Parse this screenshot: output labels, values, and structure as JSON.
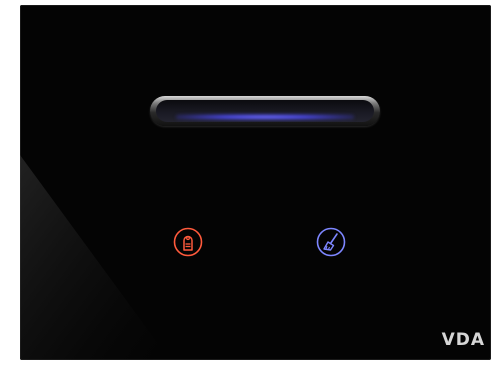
{
  "device": {
    "type": "hotel room keycard switch panel",
    "panel_color": "#040404",
    "card_slot": {
      "icon": "card-slot",
      "glow_color": "#5b59f0"
    },
    "buttons": [
      {
        "id": "do-not-disturb",
        "icon": "door-hanger-icon",
        "color": "#ff5a3c"
      },
      {
        "id": "make-up-room",
        "icon": "broom-icon",
        "color": "#7d86ff"
      }
    ],
    "brand": {
      "text": "VDA"
    }
  }
}
